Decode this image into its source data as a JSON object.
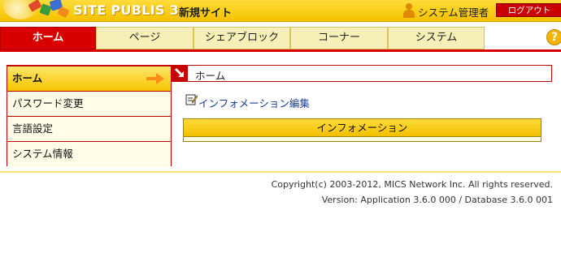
{
  "header": {
    "brand": "SITE PUBLIS 3",
    "site_name": "新規サイト",
    "user_name": "システム管理者",
    "logout_label": "ログアウト",
    "accent_color": "#d80000",
    "header_color": "#f5c200"
  },
  "tabs": [
    {
      "label": "ホーム",
      "active": true
    },
    {
      "label": "ページ",
      "active": false
    },
    {
      "label": "シェアブロック",
      "active": false
    },
    {
      "label": "コーナー",
      "active": false
    },
    {
      "label": "システム",
      "active": false
    }
  ],
  "help_icon": "help-icon",
  "sidebar": {
    "items": [
      {
        "label": "ホーム",
        "active": true
      },
      {
        "label": "パスワード変更",
        "active": false
      },
      {
        "label": "言語設定",
        "active": false
      },
      {
        "label": "システム情報",
        "active": false
      }
    ]
  },
  "main": {
    "breadcrumb": "ホーム",
    "info_edit_link": "インフォメーション編集",
    "info_panel_title": "インフォメーション"
  },
  "footer": {
    "copyright": "Copyright(c) 2003-2012, MICS Network Inc. All rights reserved.",
    "version": "Version: Application 3.6.0 000  / Database 3.6.0 001"
  }
}
